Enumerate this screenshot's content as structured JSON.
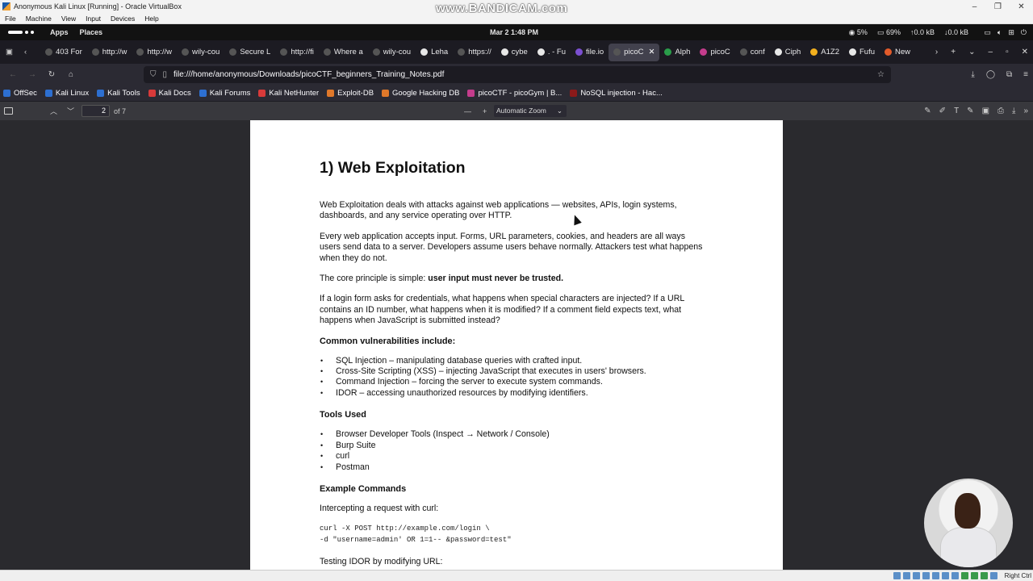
{
  "vbox": {
    "title": "Anonymous Kali Linux [Running] - Oracle VirtualBox",
    "watermark": "www.BANDICAM.com",
    "menu": [
      "File",
      "Machine",
      "View",
      "Input",
      "Devices",
      "Help"
    ],
    "host_key": "Right Ctrl"
  },
  "kali_panel": {
    "apps": "Apps",
    "places": "Places",
    "clock": "Mar 2  1:48 PM",
    "cpu": "5%",
    "mem": "69%",
    "net_up": "↑0.0 kB",
    "net_down": "↓0.0 kB"
  },
  "tabs": [
    {
      "label": "403 For",
      "color": "#555"
    },
    {
      "label": "http://w",
      "color": "#555"
    },
    {
      "label": "http://w",
      "color": "#555"
    },
    {
      "label": "wily-cou",
      "color": "#555"
    },
    {
      "label": "Secure L",
      "color": "#555"
    },
    {
      "label": "http://fi",
      "color": "#555"
    },
    {
      "label": "Where a",
      "color": "#555"
    },
    {
      "label": "wily-cou",
      "color": "#555"
    },
    {
      "label": "Leha",
      "color": "#e8e8e8"
    },
    {
      "label": "https://",
      "color": "#555"
    },
    {
      "label": "cybe",
      "color": "#e8e8e8"
    },
    {
      "label": ". - Fu",
      "color": "#e8e8e8"
    },
    {
      "label": "file.io",
      "color": "#7b4fd1"
    },
    {
      "label": "picoC",
      "color": "#555",
      "active": true
    },
    {
      "label": "Alph",
      "color": "#2a9d4a"
    },
    {
      "label": "picoC",
      "color": "#c43c8c"
    },
    {
      "label": "conf",
      "color": "#555"
    },
    {
      "label": "Ciph",
      "color": "#e8e8e8"
    },
    {
      "label": "A1Z2",
      "color": "#f2b01e"
    },
    {
      "label": "Fufu",
      "color": "#e8e8e8"
    },
    {
      "label": "New",
      "color": "#e35b2a"
    }
  ],
  "url": "file:///home/anonymous/Downloads/picoCTF_beginners_Training_Notes.pdf",
  "bookmarks": [
    {
      "label": "OffSec",
      "color": "#2d6fd1"
    },
    {
      "label": "Kali Linux",
      "color": "#2d6fd1"
    },
    {
      "label": "Kali Tools",
      "color": "#2d6fd1"
    },
    {
      "label": "Kali Docs",
      "color": "#d83a3a"
    },
    {
      "label": "Kali Forums",
      "color": "#2d6fd1"
    },
    {
      "label": "Kali NetHunter",
      "color": "#d83a3a"
    },
    {
      "label": "Exploit-DB",
      "color": "#e0782a"
    },
    {
      "label": "Google Hacking DB",
      "color": "#e0782a"
    },
    {
      "label": "picoCTF - picoGym | B...",
      "color": "#c43c8c"
    },
    {
      "label": "NoSQL injection - Hac...",
      "color": "#8b1a1a"
    }
  ],
  "pdf": {
    "page_number": "2",
    "page_count": "of 7",
    "zoom": "Automatic Zoom"
  },
  "doc": {
    "heading": "1) Web Exploitation",
    "p1": "Web Exploitation deals with attacks against web applications — websites, APIs, login systems, dashboards, and any service operating over HTTP.",
    "p2": "Every web application accepts input. Forms, URL parameters, cookies, and headers are all ways users send data to a server. Developers assume users behave normally. Attackers test what happens when they do not.",
    "p3_prefix": "The core principle is simple: ",
    "p3_bold": "user input must never be trusted.",
    "p4": "If a login form asks for credentials, what happens when special characters are injected? If a URL contains an ID number, what happens when it is modified? If a comment field expects text, what happens when JavaScript is submitted instead?",
    "vuln_heading": "Common vulnerabilities include:",
    "vulns": [
      "SQL Injection – manipulating database queries with crafted input.",
      "Cross-Site Scripting (XSS) – injecting JavaScript that executes in users' browsers.",
      "Command Injection – forcing the server to execute system commands.",
      "IDOR – accessing unauthorized resources by modifying identifiers."
    ],
    "tools_heading": "Tools Used",
    "tools": [
      "Browser Developer Tools (Inspect → Network / Console)",
      "Burp Suite",
      "curl",
      "Postman"
    ],
    "examples_heading": "Example Commands",
    "ex1_label": "Intercepting a request with curl:",
    "ex1_code": "curl -X POST http://example.com/login \\\n-d \"username=admin' OR 1=1-- &password=test\"",
    "ex2_label": "Testing IDOR by modifying URL:"
  }
}
